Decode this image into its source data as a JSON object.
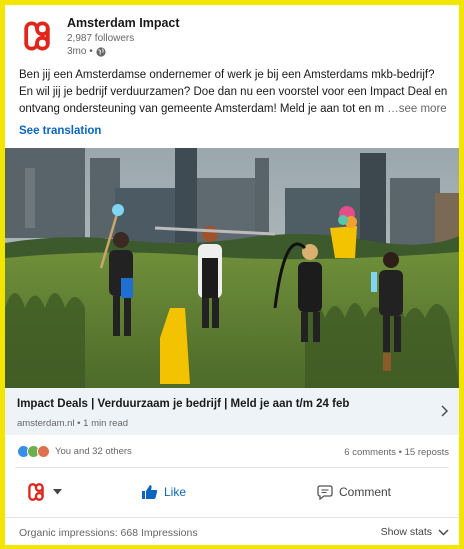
{
  "colors": {
    "brand_red": "#e1251b",
    "link_blue": "#0a66c2",
    "frame_yellow": "#f2e600"
  },
  "header": {
    "author_name": "Amsterdam Impact",
    "followers": "2,987 followers",
    "time": "3mo •",
    "logo_icon": "amsterdam-impact-logo",
    "visibility_icon": "globe-icon"
  },
  "post": {
    "text": "Ben jij een Amsterdamse ondernemer of werk je bij een Amsterdams mkb-bedrijf? En wil jij je bedrijf verduurzamen? Doe dan nu een voorstel voor een Impact Deal en ontvang ondersteuning van gemeente Amsterdam! Meld je aan tot en m",
    "see_more": "…see more",
    "see_translation": "See translation"
  },
  "link_preview": {
    "title": "Impact Deals | Verduurzaam je bedrijf | Meld je aan t/m 24 feb",
    "source": "amsterdam.nl • 1 min read"
  },
  "social": {
    "reactions_text": "You and 32 others",
    "comments_reposts": "6 comments • 15 reposts"
  },
  "actions": {
    "like_label": "Like",
    "comment_label": "Comment"
  },
  "footer": {
    "impressions": "Organic impressions: 668 Impressions",
    "show_stats": "Show stats"
  }
}
